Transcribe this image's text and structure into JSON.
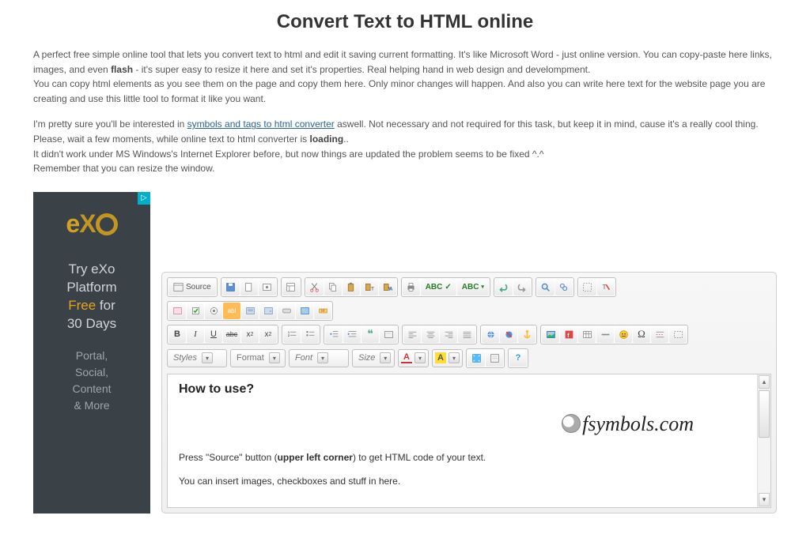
{
  "title": "Convert Text to HTML online",
  "paragraphs": {
    "p1a": "A perfect free simple online tool that lets you convert text to html and edit it saving current formatting. It's like Microsoft Word - just online version. You can copy-paste here links, images, and even ",
    "flash": "flash",
    "p1b": " - it's super easy to resize it here and set it's properties. Real helping hand in web design and develompment.",
    "p1c": "You can copy html elements as you see them on the page and copy them here. Only minor changes will happen. And also you can write here text for the website page you are creating and use this little tool to format it like you want.",
    "p2a": "I'm pretty sure you'll be interested in ",
    "link": "symbols and tags to html converter",
    "p2b": " aswell. Not necessary and not required for this task, but keep it in mind, cause it's a really cool thing.",
    "p2c": "Please, wait a few moments, while online text to html converter is ",
    "loading": "loading",
    "p2d": "..",
    "p2e": "It didn't work under MS Windows's Internet Explorer before, but now things are updated the problem seems to be fixed ^.^",
    "p2f": "Remember that you can resize the window."
  },
  "ad": {
    "logo": "eXo",
    "line1": "Try eXo",
    "line2": "Platform",
    "line3_free": "Free",
    "line3_rest": " for",
    "line4": "30 Days",
    "sub1": "Portal,",
    "sub2": "Social,",
    "sub3": "Content",
    "sub4": "& More"
  },
  "toolbar": {
    "source": "Source",
    "styles": "Styles",
    "format": "Format",
    "font": "Font",
    "size": "Size"
  },
  "editor": {
    "heading": "How to use?",
    "watermark": "fsymbols.com",
    "p1a": "Press \"Source\" button (",
    "p1b": "upper left corner",
    "p1c": ") to get HTML code of your text.",
    "p2": "You can insert images, checkboxes and stuff in here."
  }
}
